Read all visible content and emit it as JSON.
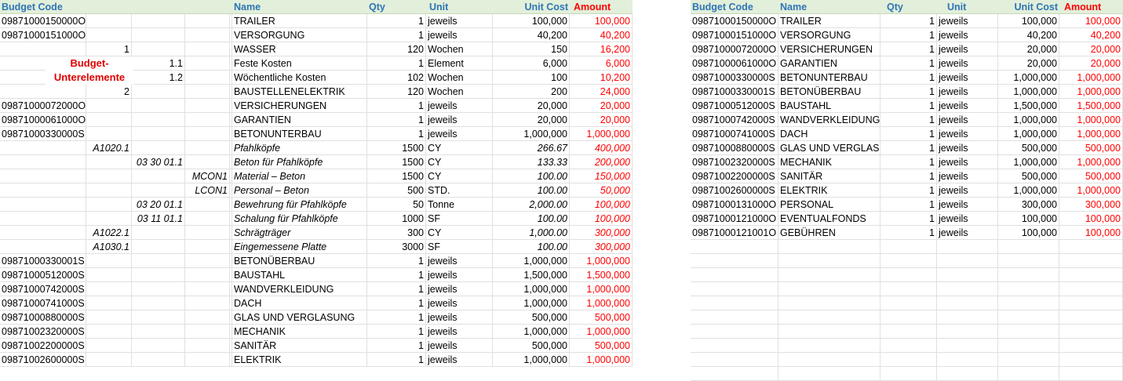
{
  "headers": {
    "budget_code": "Budget Code",
    "name": "Name",
    "qty": "Qty",
    "unit": "Unit",
    "unit_cost": "Unit Cost",
    "amount": "Amount"
  },
  "annotation": {
    "line1": "Budget-",
    "line2": "Unterelemente"
  },
  "left_rows": [
    {
      "code": "09871000150000O",
      "l1": "",
      "l2": "",
      "l3": "",
      "l4": "",
      "name": "TRAILER",
      "qty": "1",
      "unit": "jeweils",
      "cost": "100,000",
      "amount": "100,000",
      "italic": false
    },
    {
      "code": "09871000151000O",
      "l1": "",
      "l2": "",
      "l3": "",
      "l4": "",
      "name": "VERSORGUNG",
      "qty": "1",
      "unit": "jeweils",
      "cost": "40,200",
      "amount": "40,200",
      "italic": false
    },
    {
      "code": "",
      "l1": "1",
      "l2": "",
      "l3": "",
      "l4": "",
      "name": "WASSER",
      "qty": "120",
      "unit": "Wochen",
      "cost": "150",
      "amount": "16,200",
      "italic": false
    },
    {
      "code": "",
      "l1": "",
      "l2": "1.1",
      "l3": "",
      "l4": "",
      "name": "Feste Kosten",
      "qty": "1",
      "unit": "Element",
      "cost": "6,000",
      "amount": "6,000",
      "italic": false
    },
    {
      "code": "",
      "l1": "",
      "l2": "1.2",
      "l3": "",
      "l4": "",
      "name": "Wöchentliche Kosten",
      "qty": "102",
      "unit": "Wochen",
      "cost": "100",
      "amount": "10,200",
      "italic": false
    },
    {
      "code": "",
      "l1": "2",
      "l2": "",
      "l3": "",
      "l4": "",
      "name": "BAUSTELLENELEKTRIK",
      "qty": "120",
      "unit": "Wochen",
      "cost": "200",
      "amount": "24,000",
      "italic": false
    },
    {
      "code": "09871000072000O",
      "l1": "",
      "l2": "",
      "l3": "",
      "l4": "",
      "name": "VERSICHERUNGEN",
      "qty": "1",
      "unit": "jeweils",
      "cost": "20,000",
      "amount": "20,000",
      "italic": false
    },
    {
      "code": "09871000061000O",
      "l1": "",
      "l2": "",
      "l3": "",
      "l4": "",
      "name": "GARANTIEN",
      "qty": "1",
      "unit": "jeweils",
      "cost": "20,000",
      "amount": "20,000",
      "italic": false
    },
    {
      "code": " 09871000330000S",
      "l1": "",
      "l2": "",
      "l3": "",
      "l4": "",
      "name": "BETONUNTERBAU",
      "qty": "1",
      "unit": "jeweils",
      "cost": "1,000,000",
      "amount": "1,000,000",
      "italic": false
    },
    {
      "code": "",
      "l1": "A1020.1",
      "l2": "",
      "l3": "",
      "l4": "",
      "name": "Pfahlköpfe",
      "qty": "1500",
      "unit": "CY",
      "cost": "266.67",
      "amount": "400,000",
      "italic": true
    },
    {
      "code": "",
      "l1": "",
      "l2": "03 30 01.1",
      "l3": "",
      "l4": "",
      "name": "Beton für Pfahlköpfe",
      "qty": "1500",
      "unit": "CY",
      "cost": "133.33",
      "amount": "200,000",
      "italic": true
    },
    {
      "code": "",
      "l1": "",
      "l2": "",
      "l3": "MCON1",
      "l4": "",
      "name": "Material – Beton",
      "qty": "1500",
      "unit": "CY",
      "cost": "100.00",
      "amount": "150,000",
      "italic": true
    },
    {
      "code": "",
      "l1": "",
      "l2": "",
      "l3": "LCON1",
      "l4": "",
      "name": "Personal – Beton",
      "qty": "500",
      "unit": "STD.",
      "cost": "100.00",
      "amount": "50,000",
      "italic": true
    },
    {
      "code": "",
      "l1": "",
      "l2": "03 20 01.1",
      "l3": "",
      "l4": "",
      "name": "Bewehrung für Pfahlköpfe",
      "qty": "50",
      "unit": "Tonne",
      "cost": "2,000.00",
      "amount": "100,000",
      "italic": true
    },
    {
      "code": "",
      "l1": "",
      "l2": "03 11 01.1",
      "l3": "",
      "l4": "",
      "name": "Schalung für Pfahlköpfe",
      "qty": "1000",
      "unit": "SF",
      "cost": "100.00",
      "amount": "100,000",
      "italic": true
    },
    {
      "code": "",
      "l1": "A1022.1",
      "l2": "",
      "l3": "",
      "l4": "",
      "name": "Schrägträger",
      "qty": "300",
      "unit": "CY",
      "cost": "1,000.00",
      "amount": "300,000",
      "italic": true
    },
    {
      "code": "",
      "l1": "A1030.1",
      "l2": "",
      "l3": "",
      "l4": "",
      "name": "Eingemessene Platte",
      "qty": "3000",
      "unit": "SF",
      "cost": "100.00",
      "amount": "300,000",
      "italic": true
    },
    {
      "code": " 09871000330001S",
      "l1": "",
      "l2": "",
      "l3": "",
      "l4": "",
      "name": "BETONÜBERBAU",
      "qty": "1",
      "unit": "jeweils",
      "cost": "1,000,000",
      "amount": "1,000,000",
      "italic": false
    },
    {
      "code": " 09871000512000S",
      "l1": "",
      "l2": "",
      "l3": "",
      "l4": "",
      "name": "BAUSTAHL",
      "qty": "1",
      "unit": "jeweils",
      "cost": "1,500,000",
      "amount": "1,500,000",
      "italic": false
    },
    {
      "code": " 09871000742000S",
      "l1": "",
      "l2": "",
      "l3": "",
      "l4": "",
      "name": "WANDVERKLEIDUNG",
      "qty": "1",
      "unit": "jeweils",
      "cost": "1,000,000",
      "amount": "1,000,000",
      "italic": false
    },
    {
      "code": " 09871000741000S",
      "l1": "",
      "l2": "",
      "l3": "",
      "l4": "",
      "name": "DACH",
      "qty": "1",
      "unit": "jeweils",
      "cost": "1,000,000",
      "amount": "1,000,000",
      "italic": false
    },
    {
      "code": " 09871000880000S",
      "l1": "",
      "l2": "",
      "l3": "",
      "l4": "",
      "name": "GLAS UND VERGLASUNG",
      "qty": "1",
      "unit": "jeweils",
      "cost": "500,000",
      "amount": "500,000",
      "italic": false
    },
    {
      "code": " 09871002320000S",
      "l1": "",
      "l2": "",
      "l3": "",
      "l4": "",
      "name": "MECHANIK",
      "qty": "1",
      "unit": "jeweils",
      "cost": "1,000,000",
      "amount": "1,000,000",
      "italic": false
    },
    {
      "code": " 09871002200000S",
      "l1": "",
      "l2": "",
      "l3": "",
      "l4": "",
      "name": "SANITÄR",
      "qty": "1",
      "unit": "jeweils",
      "cost": "500,000",
      "amount": "500,000",
      "italic": false
    },
    {
      "code": " 09871002600000S",
      "l1": "",
      "l2": "",
      "l3": "",
      "l4": "",
      "name": "ELEKTRIK",
      "qty": "1",
      "unit": "jeweils",
      "cost": "1,000,000",
      "amount": "1,000,000",
      "italic": false
    }
  ],
  "right_rows": [
    {
      "code": "09871000150000O",
      "name": "TRAILER",
      "qty": "1",
      "unit": "jeweils",
      "cost": "100,000",
      "amount": "100,000"
    },
    {
      "code": "09871000151000O",
      "name": "VERSORGUNG",
      "qty": "1",
      "unit": "jeweils",
      "cost": "40,200",
      "amount": "40,200"
    },
    {
      "code": "09871000072000O",
      "name": "VERSICHERUNGEN",
      "qty": "1",
      "unit": "jeweils",
      "cost": "20,000",
      "amount": "20,000"
    },
    {
      "code": "09871000061000O",
      "name": "GARANTIEN",
      "qty": "1",
      "unit": "jeweils",
      "cost": "20,000",
      "amount": "20,000"
    },
    {
      "code": " 09871000330000S",
      "name": "BETONUNTERBAU",
      "qty": "1",
      "unit": "jeweils",
      "cost": "1,000,000",
      "amount": "1,000,000"
    },
    {
      "code": " 09871000330001S",
      "name": "BETONÜBERBAU",
      "qty": "1",
      "unit": "jeweils",
      "cost": "1,000,000",
      "amount": "1,000,000"
    },
    {
      "code": " 09871000512000S",
      "name": "BAUSTAHL",
      "qty": "1",
      "unit": "jeweils",
      "cost": "1,500,000",
      "amount": "1,500,000"
    },
    {
      "code": " 09871000742000S",
      "name": "WANDVERKLEIDUNG",
      "qty": "1",
      "unit": "jeweils",
      "cost": "1,000,000",
      "amount": "1,000,000"
    },
    {
      "code": " 09871000741000S",
      "name": "DACH",
      "qty": "1",
      "unit": "jeweils",
      "cost": "1,000,000",
      "amount": "1,000,000"
    },
    {
      "code": " 09871000880000S",
      "name": "GLAS UND VERGLASU",
      "qty": "1",
      "unit": "jeweils",
      "cost": "500,000",
      "amount": "500,000"
    },
    {
      "code": " 09871002320000S",
      "name": "MECHANIK",
      "qty": "1",
      "unit": "jeweils",
      "cost": "1,000,000",
      "amount": "1,000,000"
    },
    {
      "code": " 09871002200000S",
      "name": "SANITÄR",
      "qty": "1",
      "unit": "jeweils",
      "cost": "500,000",
      "amount": "500,000"
    },
    {
      "code": " 09871002600000S",
      "name": "ELEKTRIK",
      "qty": "1",
      "unit": "jeweils",
      "cost": "1,000,000",
      "amount": "1,000,000"
    },
    {
      "code": "09871000131000O",
      "name": "PERSONAL",
      "qty": "1",
      "unit": "jeweils",
      "cost": "300,000",
      "amount": "300,000"
    },
    {
      "code": "09871000121000O",
      "name": "EVENTUALFONDS",
      "qty": "1",
      "unit": "jeweils",
      "cost": "100,000",
      "amount": "100,000"
    },
    {
      "code": "09871000121001O",
      "name": "GEBÜHREN",
      "qty": "1",
      "unit": "jeweils",
      "cost": "100,000",
      "amount": "100,000"
    }
  ]
}
